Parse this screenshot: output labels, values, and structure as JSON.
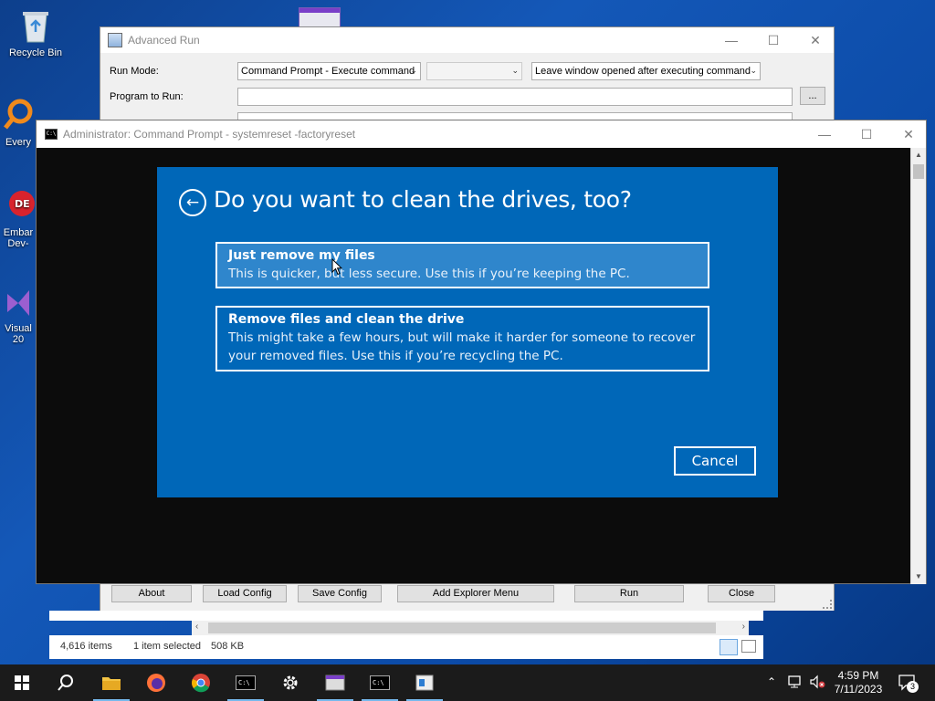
{
  "desktop": {
    "icons": [
      {
        "label": "Recycle Bin"
      },
      {
        "label": "Every"
      },
      {
        "label": "Embar Dev-"
      },
      {
        "label": "Visual 20"
      }
    ]
  },
  "advanced_run": {
    "title": "Advanced Run",
    "run_mode_label": "Run Mode:",
    "run_mode_value": "Command Prompt - Execute command",
    "secondary_value": "",
    "window_option_value": "Leave window opened after executing command",
    "program_label": "Program to Run:",
    "program_value": "",
    "browse_label": "...",
    "buttons": {
      "about": "About",
      "load_config": "Load Config",
      "save_config": "Save Config",
      "add_explorer_menu": "Add Explorer Menu",
      "run": "Run",
      "close": "Close"
    }
  },
  "explorer": {
    "items_count": "4,616 items",
    "selection": "1 item selected",
    "size": "508 KB"
  },
  "cmd": {
    "title": "Administrator:  Command Prompt - systemreset  -factoryreset"
  },
  "reset_dialog": {
    "heading": "Do you want to clean the drives, too?",
    "options": [
      {
        "title": "Just remove my files",
        "desc": "This is quicker, but less secure. Use this if you’re keeping the PC."
      },
      {
        "title": "Remove files and clean the drive",
        "desc": "This might take a few hours, but will make it harder for someone to recover your removed files. Use this if you’re recycling the PC."
      }
    ],
    "cancel": "Cancel",
    "accent_color": "#0067b8"
  },
  "taskbar": {
    "time": "4:59 PM",
    "date": "7/11/2023",
    "notifications": "3"
  }
}
